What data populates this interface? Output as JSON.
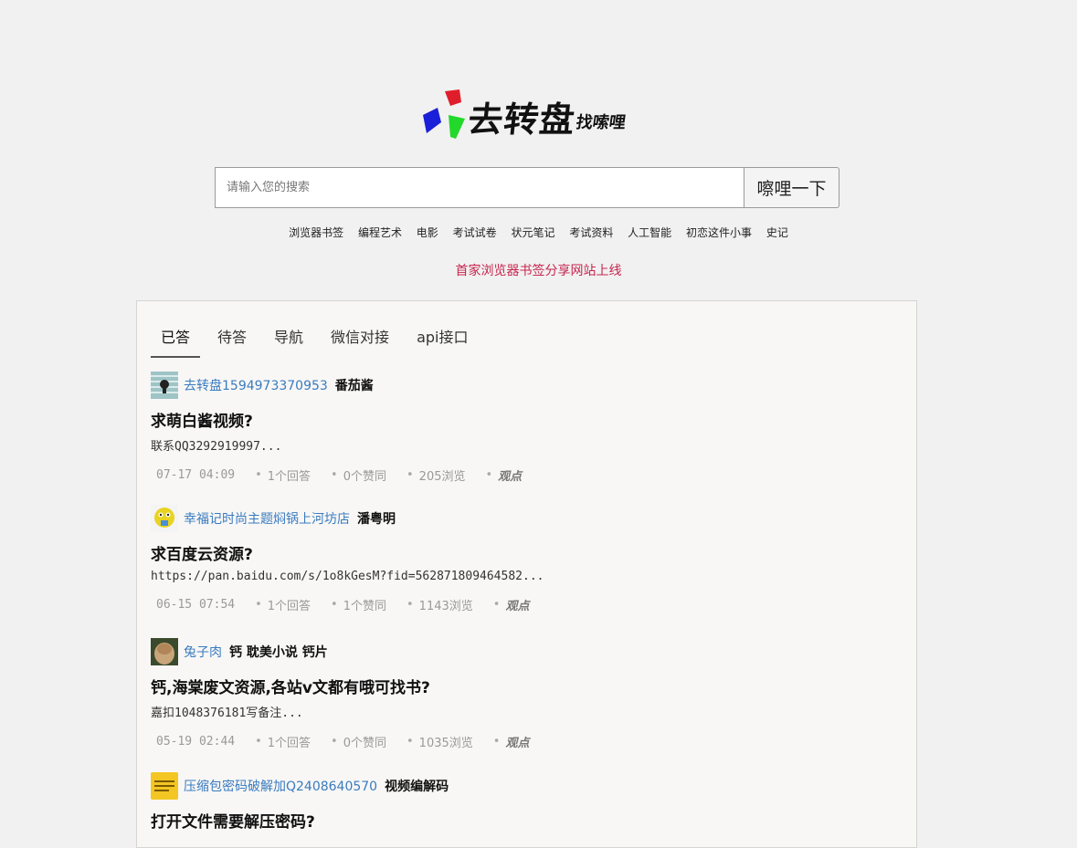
{
  "logo": {
    "main": "去转盘",
    "sub": "找嗦哩",
    "colors": [
      "#e01e2b",
      "#1a1fd8",
      "#22d82a"
    ]
  },
  "search": {
    "placeholder": "请输入您的搜索",
    "button": "嚓哩一下"
  },
  "hotwords": [
    "浏览器书签",
    "编程艺术",
    "电影",
    "考试试卷",
    "状元笔记",
    "考试资料",
    "人工智能",
    "初恋这件小事",
    "史记"
  ],
  "announcement": "首家浏览器书签分享网站上线",
  "tabs": [
    "已答",
    "待答",
    "导航",
    "微信对接",
    "api接口"
  ],
  "questions": [
    {
      "user": "去转盘1594973370953",
      "topic": "番茄酱",
      "title": "求萌白酱视频?",
      "excerpt": "联系QQ3292919997...",
      "time": "07-17 04:09",
      "answers": "1个回答",
      "likes": "0个赞同",
      "views": "205浏览",
      "viewpoint": "观点"
    },
    {
      "user": "幸福记时尚主题焖锅上河坊店",
      "topic": "潘粤明",
      "title": "求百度云资源?",
      "excerpt": "https://pan.baidu.com/s/1o8kGesM?fid=562871809464582...",
      "time": "06-15 07:54",
      "answers": "1个回答",
      "likes": "1个赞同",
      "views": "1143浏览",
      "viewpoint": "观点"
    },
    {
      "user": "兔子肉",
      "topic": "钙 耽美小说 钙片",
      "title": "钙,海棠废文资源,各站v文都有哦可找书?",
      "excerpt": "嘉扣1048376181写备注...",
      "time": "05-19 02:44",
      "answers": "1个回答",
      "likes": "0个赞同",
      "views": "1035浏览",
      "viewpoint": "观点"
    },
    {
      "user": "压缩包密码破解加Q2408640570",
      "topic": "视频编解码",
      "title": "打开文件需要解压密码?"
    }
  ]
}
